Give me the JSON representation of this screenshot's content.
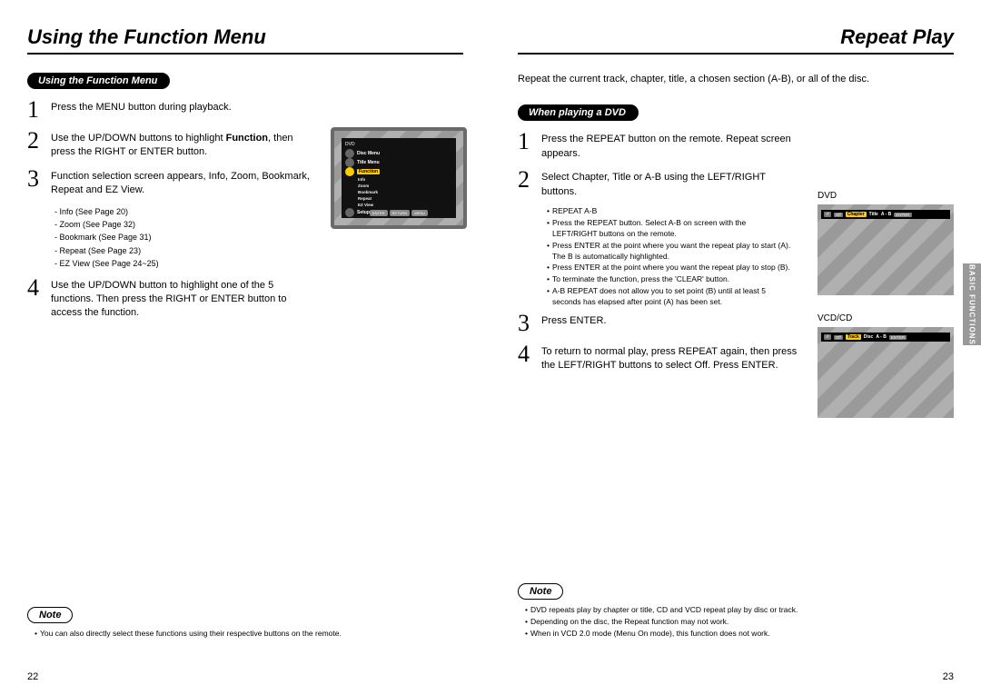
{
  "left": {
    "title": "Using the Function Menu",
    "section_pill": "Using the Function Menu",
    "steps": [
      {
        "num": "1",
        "text": "Press the MENU button during playback."
      },
      {
        "num": "2",
        "text_pre": "Use the UP/DOWN buttons to highlight ",
        "text_bold": "Function",
        "text_post": ", then press the RIGHT or ENTER button."
      },
      {
        "num": "3",
        "text": "Function selection screen appears, Info, Zoom, Bookmark, Repeat and EZ View."
      },
      {
        "num": "4",
        "text": "Use the UP/DOWN button to highlight one of the 5 functions. Then press the RIGHT or ENTER button to access the function."
      }
    ],
    "sublist": [
      "Info (See Page 20)",
      "Zoom (See Page 32)",
      "Bookmark (See Page 31)",
      "Repeat (See Page 23)",
      "EZ View (See Page 24~25)"
    ],
    "tv_menu": {
      "header": "DVD",
      "rows": [
        {
          "label": "Disc Menu"
        },
        {
          "label": "Title Menu"
        },
        {
          "label": "Function",
          "hl": true
        }
      ],
      "sub": [
        "Info",
        "Zoom",
        "Bookmark",
        "Repeat",
        "EZ View"
      ],
      "last": "Setup",
      "buttons": [
        "ENTER",
        "RETURN",
        "MENU"
      ]
    },
    "note_pill": "Note",
    "note_bullets": [
      "You can also directly select these functions using their respective buttons on the remote."
    ],
    "page_no": "22"
  },
  "right": {
    "title": "Repeat Play",
    "intro": "Repeat the current track, chapter, title, a chosen section (A-B), or all of the disc.",
    "section_pill": "When playing a DVD",
    "steps": [
      {
        "num": "1",
        "text": "Press the REPEAT button on the remote. Repeat screen appears."
      },
      {
        "num": "2",
        "text": "Select Chapter, Title or A-B using the LEFT/RIGHT buttons."
      },
      {
        "num": "3",
        "text": "Press ENTER."
      },
      {
        "num": "4",
        "text": "To return to normal play, press REPEAT again, then press the LEFT/RIGHT buttons to select Off. Press ENTER."
      }
    ],
    "repeat_bullets": [
      "REPEAT A-B",
      "Press the REPEAT button. Select A-B on screen with the LEFT/RIGHT buttons on the remote.",
      "Press ENTER at the point where you want the repeat play to start (A). The B is automatically highlighted.",
      "Press ENTER at the point where you want the repeat play to stop (B).",
      "To terminate the function, press the 'CLEAR' button.",
      "A-B REPEAT does not allow you to set point (B) until at least 5 seconds has elapsed after point (A) has been set."
    ],
    "osd": {
      "dvd_label": "DVD",
      "dvd_strip": {
        "icons": [
          "↺",
          "Off"
        ],
        "segs": [
          "Chapter",
          "Title",
          "A - B"
        ],
        "btn": "ENTER"
      },
      "vcd_label": "VCD/CD",
      "vcd_strip": {
        "icons": [
          "↺",
          "Off"
        ],
        "segs": [
          "Track",
          "Disc",
          "A - B"
        ],
        "btn": "ENTER"
      }
    },
    "side_tab": "BASIC FUNCTIONS",
    "note_pill": "Note",
    "note_bullets": [
      "DVD repeats play by chapter or title, CD and VCD repeat play by disc or track.",
      "Depending on the disc, the Repeat function may not work.",
      "When in VCD 2.0 mode (Menu On mode), this function does not work."
    ],
    "page_no": "23"
  }
}
